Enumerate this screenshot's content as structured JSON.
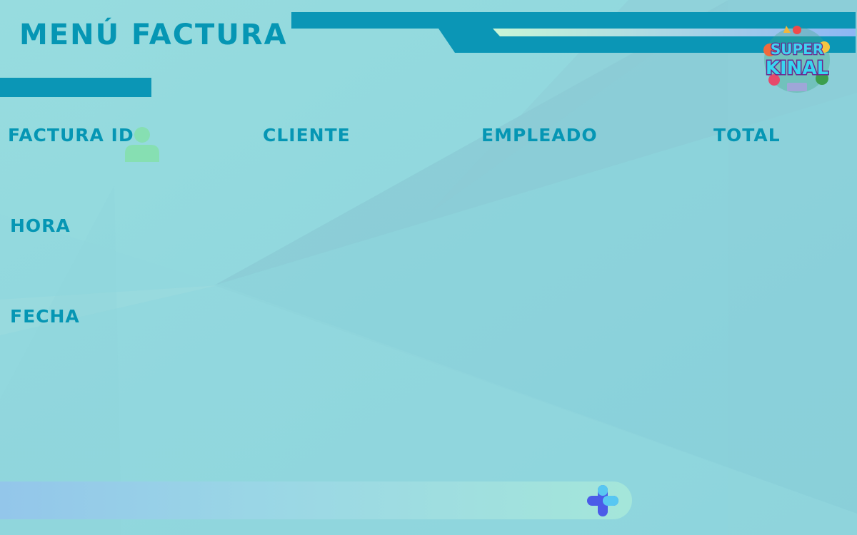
{
  "header": {
    "title": "MENÚ FACTURA"
  },
  "fields": {
    "factura_id": "FACTURA ID",
    "cliente": "CLIENTE",
    "empleado": "EMPLEADO",
    "total": "TOTAL",
    "hora": "HORA",
    "fecha": "FECHA"
  },
  "logo": {
    "line1": "SUPER",
    "line2": "KINAL"
  },
  "icons": {
    "user": "user-icon",
    "add": "plus-icon"
  },
  "colors": {
    "primary": "#0596b4",
    "accent_bar": "#0b96b6",
    "background": "#8fd8de",
    "user_icon": "#86dfb2",
    "plus_blue": "#4b5be8",
    "plus_cyan": "#58c7f2"
  }
}
